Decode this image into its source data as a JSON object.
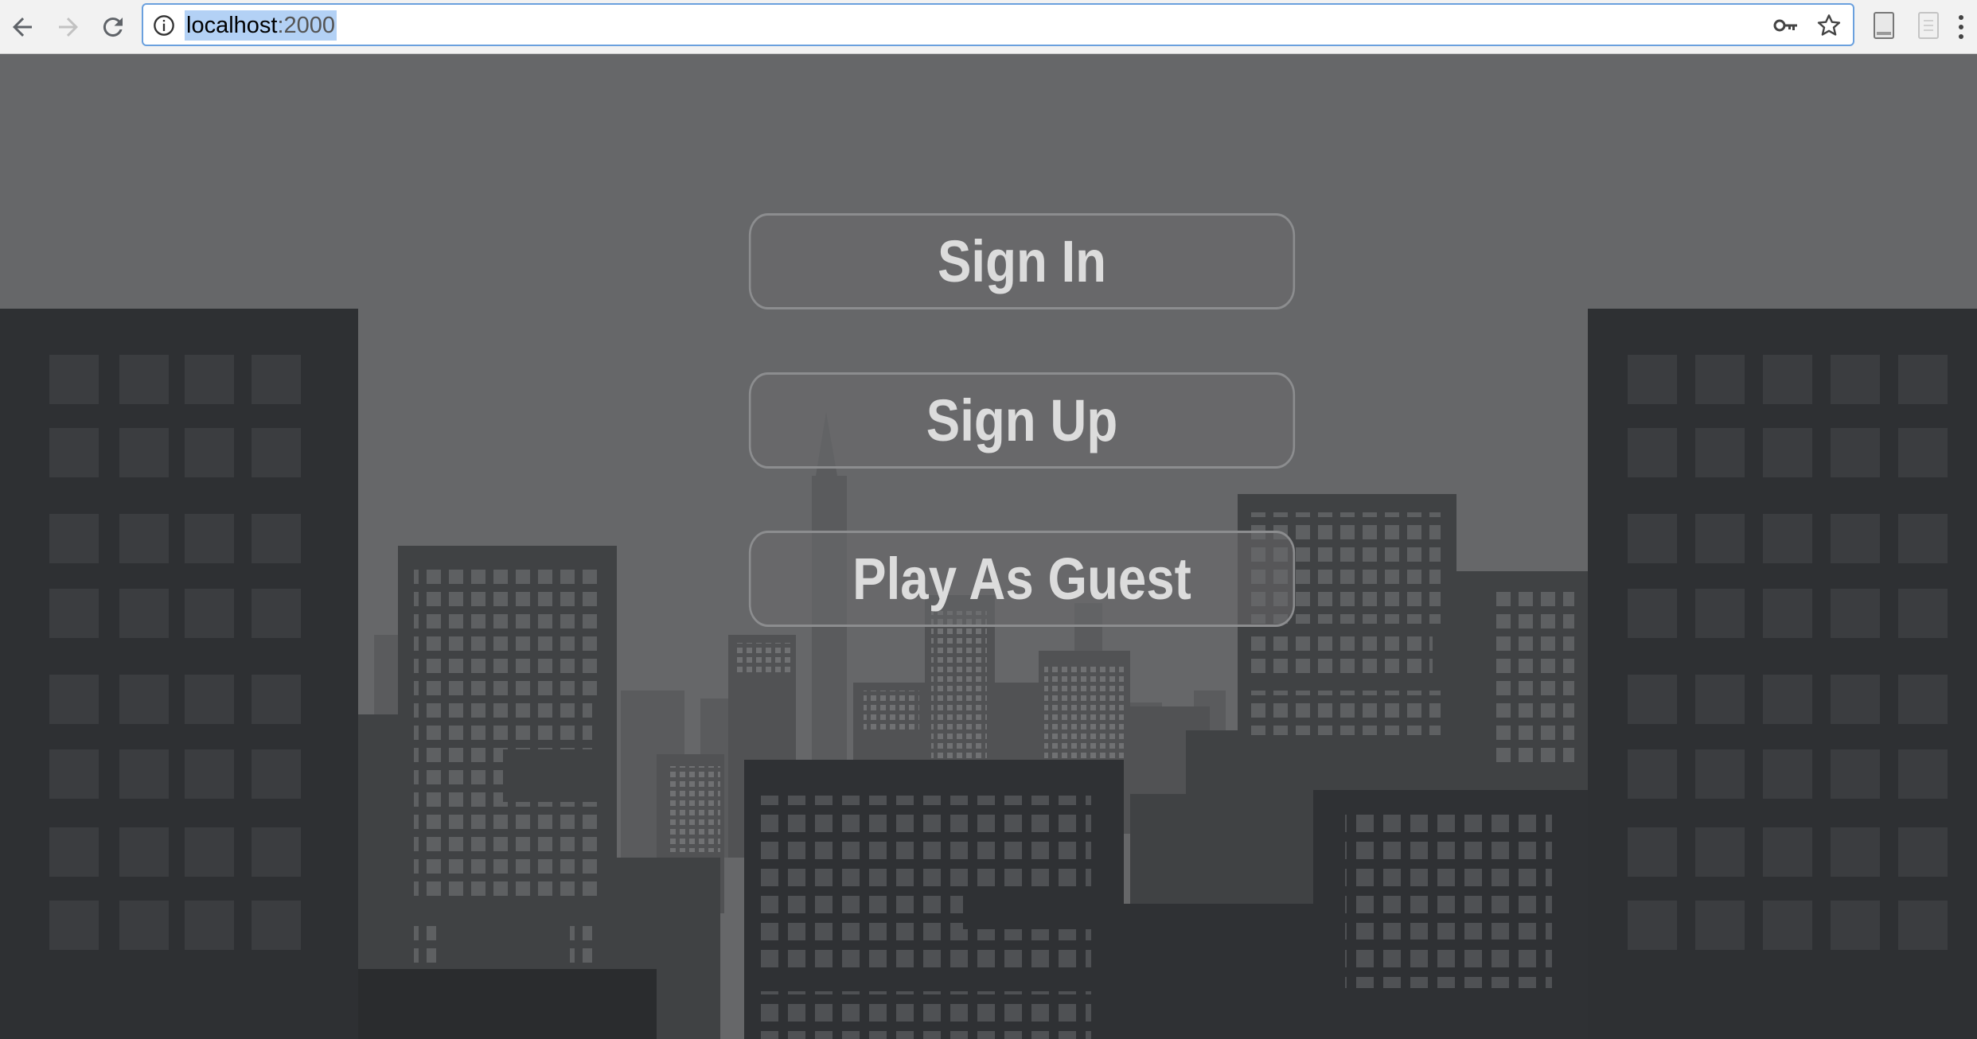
{
  "browser": {
    "url_host": "localhost",
    "url_port": ":2000",
    "icons": {
      "back": "back-arrow-icon",
      "forward": "forward-arrow-icon",
      "reload": "reload-icon",
      "info": "info-icon",
      "key": "key-icon",
      "star": "star-icon",
      "menu": "menu-dots-icon"
    }
  },
  "menu": {
    "sign_in": "Sign In",
    "sign_up": "Sign Up",
    "guest": "Play As Guest"
  },
  "colors": {
    "sky": "#666769",
    "near_buildings": "#2e3033",
    "mid_buildings": "#3b3d40",
    "far_buildings": "#555658",
    "button_text": "#dcdcdc"
  }
}
